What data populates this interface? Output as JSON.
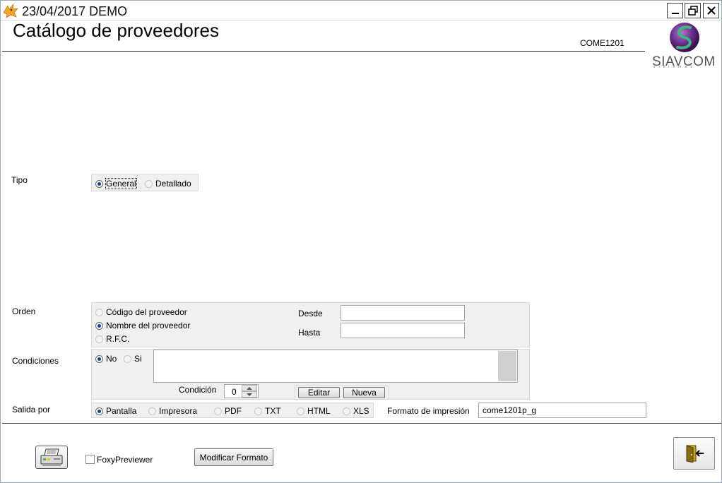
{
  "window": {
    "title": "23/04/2017  DEMO"
  },
  "header": {
    "page_title": "Catálogo de proveedores",
    "form_code": "COME1201",
    "logo_text": "SIAVCOM",
    "logo_subtext": "sistemas"
  },
  "tipo": {
    "label": "Tipo",
    "options": [
      {
        "label": "General",
        "selected": true
      },
      {
        "label": "Detallado",
        "selected": false
      }
    ]
  },
  "orden": {
    "label": "Orden",
    "options": [
      {
        "label": "Código del proveedor",
        "selected": false
      },
      {
        "label": "Nombre del proveedor",
        "selected": true
      },
      {
        "label": "R.F.C.",
        "selected": false
      }
    ],
    "desde_label": "Desde",
    "desde_value": "",
    "hasta_label": "Hasta",
    "hasta_value": ""
  },
  "condiciones": {
    "label": "Condiciones",
    "options": [
      {
        "label": "No",
        "selected": true
      },
      {
        "label": "Si",
        "selected": false
      }
    ],
    "text_value": "",
    "condicion_label": "Condición",
    "condicion_value": "0",
    "editar_label": "Editar",
    "nueva_label": "Nueva"
  },
  "salida": {
    "label": "Salida por",
    "options": [
      {
        "label": "Pantalla",
        "selected": true
      },
      {
        "label": "Impresora",
        "selected": false
      },
      {
        "label": "PDF",
        "selected": false
      },
      {
        "label": "TXT",
        "selected": false
      },
      {
        "label": "HTML",
        "selected": false
      },
      {
        "label": "XLS",
        "selected": false
      }
    ],
    "formato_label": "Formato de impresión",
    "formato_value": "come1201p_g"
  },
  "footer": {
    "foxy_label": "FoxyPreviewer",
    "foxy_checked": false,
    "modificar_label": "Modificar Formato"
  },
  "icons": {
    "app": "fox-icon",
    "print": "printer-icon",
    "exit": "exit-door-icon"
  },
  "colors": {
    "radio_dot": "#1e3f9a",
    "panel_bg": "#f0f0f0",
    "logo_purple": "#6a2c8e",
    "logo_green": "#2f9a6a"
  }
}
